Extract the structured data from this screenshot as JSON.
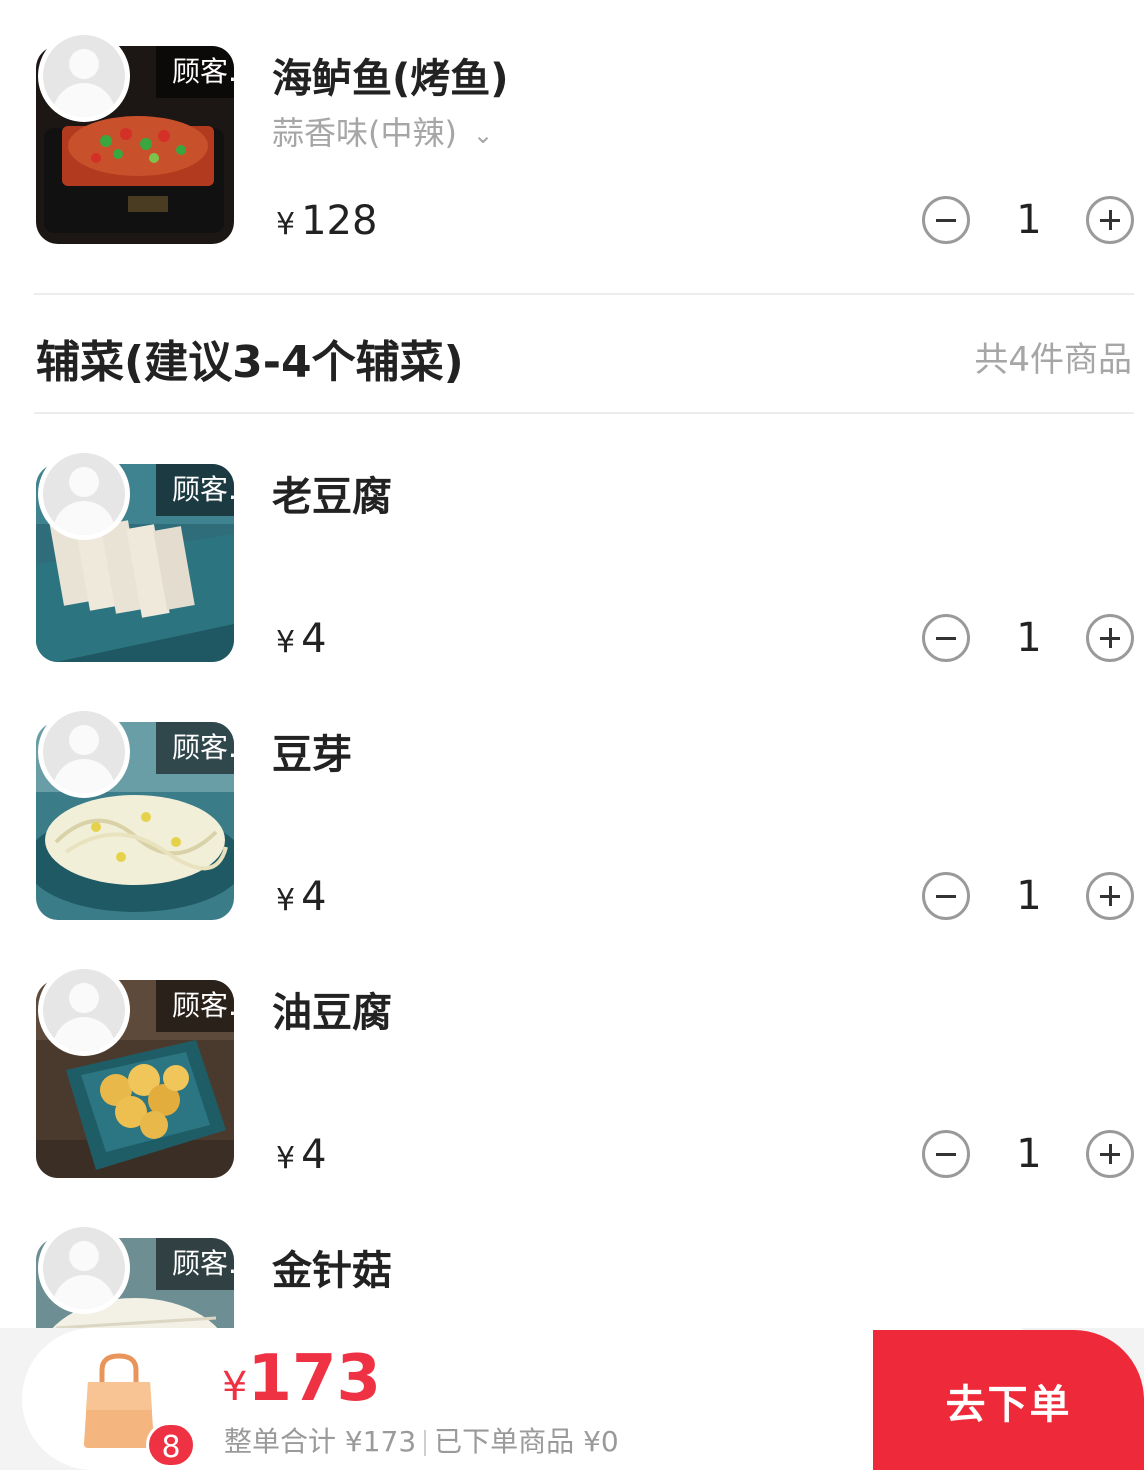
{
  "main_item": {
    "name": "海鲈鱼(烤鱼)",
    "variant": "蒜香味(中辣)",
    "price_symbol": "¥",
    "price": "128",
    "quantity": "1",
    "customer_label": "顾客..."
  },
  "section": {
    "title": "辅菜(建议3-4个辅菜)",
    "count": "共4件商品"
  },
  "side_items": [
    {
      "name": "老豆腐",
      "price_symbol": "¥",
      "price": "4",
      "quantity": "1",
      "customer_label": "顾客..."
    },
    {
      "name": "豆芽",
      "price_symbol": "¥",
      "price": "4",
      "quantity": "1",
      "customer_label": "顾客..."
    },
    {
      "name": "油豆腐",
      "price_symbol": "¥",
      "price": "4",
      "quantity": "1",
      "customer_label": "顾客..."
    },
    {
      "name": "金针菇",
      "customer_label": "顾客..."
    }
  ],
  "cart": {
    "badge_count": "8",
    "total_symbol": "¥",
    "total": "173",
    "order_total_text": "整单合计 ¥173",
    "ordered_text": "已下单商品 ¥0",
    "submit_label": "去下单"
  },
  "colors": {
    "accent": "#ee2a3a",
    "muted_text": "#a6a6a6",
    "bag": "#f5b57f"
  },
  "icons": {
    "stepper_minus": "minus-circle-icon",
    "stepper_plus": "plus-circle-icon",
    "variant_dropdown": "chevron-down-icon",
    "cart": "shopping-bag-icon",
    "avatar": "user-avatar-icon"
  }
}
